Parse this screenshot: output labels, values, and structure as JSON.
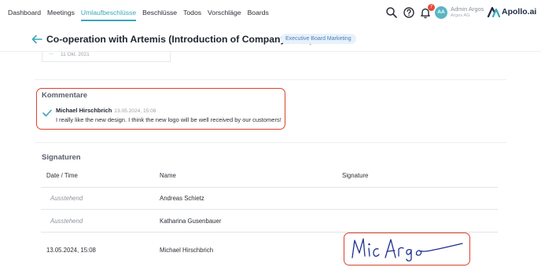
{
  "nav": {
    "items": [
      {
        "label": "Dashboard",
        "active": false
      },
      {
        "label": "Meetings",
        "active": false
      },
      {
        "label": "Umlaufbeschlüsse",
        "active": true
      },
      {
        "label": "Beschlüsse",
        "active": false
      },
      {
        "label": "Todos",
        "active": false
      },
      {
        "label": "Vorschläge",
        "active": false
      },
      {
        "label": "Boards",
        "active": false
      }
    ],
    "notification_count": "7",
    "user": {
      "initials": "AA",
      "name": "Admin Argos",
      "org": "Argos AG"
    },
    "logo_text": "Apollo.ai",
    "icons": [
      "search-icon",
      "help-icon",
      "bell-icon",
      "apollo-logo-icon"
    ]
  },
  "header": {
    "title": "Co-operation with Artemis (Introduction of Company Coin)",
    "tag": "Executive Board Marketing"
  },
  "previous_card": {
    "date": "11 Okt. 2021"
  },
  "comments": {
    "section_title": "Kommentare",
    "items": [
      {
        "author": "Michael Hirschbrich",
        "date": "13.05.2024, 15:08",
        "text": "I really like the new design. I think the new logo will be well received by our customers!"
      }
    ]
  },
  "signatures": {
    "section_title": "Signaturen",
    "columns": [
      "Date / Time",
      "Name",
      "Signature"
    ],
    "rows": [
      {
        "date": "Ausstehend",
        "name": "Andreas Schietz",
        "pending": true
      },
      {
        "date": "Ausstehend",
        "name": "Katharina Gusenbauer",
        "pending": true
      },
      {
        "date": "13.05.2024, 15:08",
        "name": "Michael Hirschbrich",
        "pending": false,
        "signature_text": "Mic Argos"
      }
    ]
  },
  "colors": {
    "accent": "#3aa7b8",
    "highlight_border": "#d9442e",
    "tag_bg": "#e8f2fb",
    "signature_ink": "#1f2f8f"
  }
}
